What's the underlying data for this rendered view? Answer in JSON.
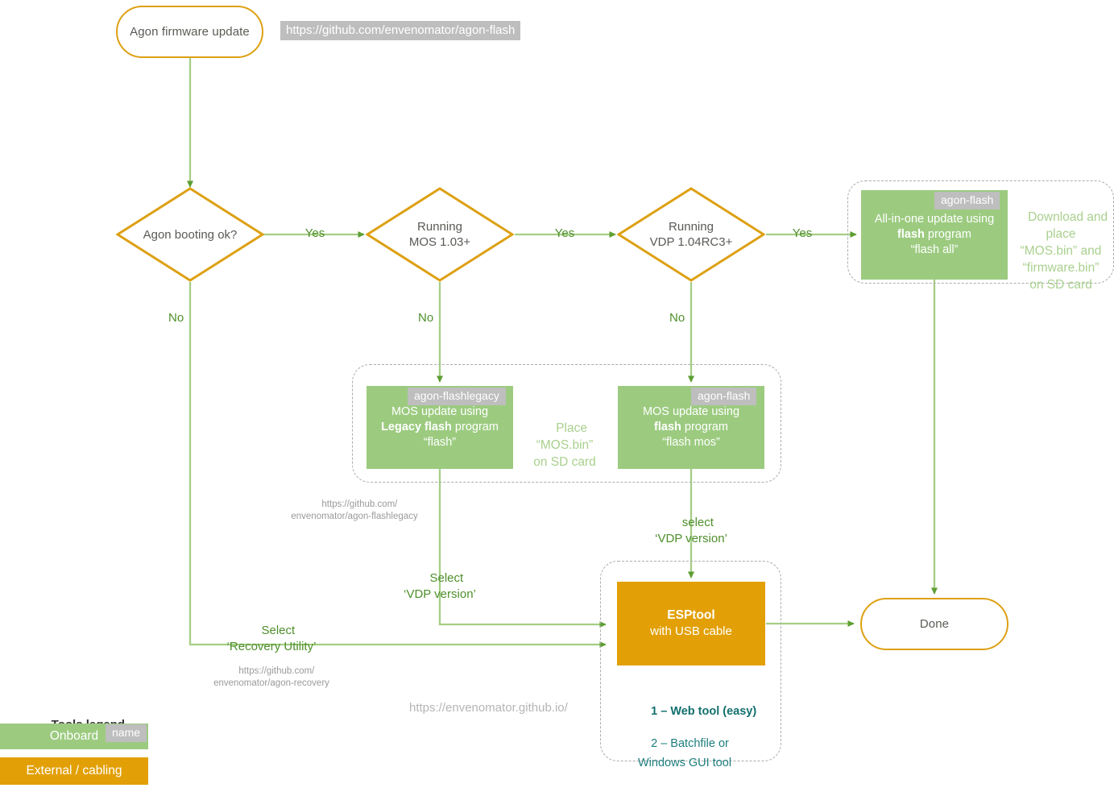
{
  "diagram": {
    "title_node": "Agon firmware update",
    "top_url": "https://github.com/envenomator/agon-flash",
    "end_node": "Done"
  },
  "decisions": [
    {
      "id": "boot",
      "text": "Agon booting ok?",
      "yes": "Yes",
      "no": "No"
    },
    {
      "id": "mos",
      "line1": "Running",
      "line2": "MOS 1.03+",
      "yes": "Yes",
      "no": "No"
    },
    {
      "id": "vdp",
      "line1": "Running",
      "line2": "VDP 1.04RC3+",
      "yes": "Yes",
      "no": "No"
    }
  ],
  "processes": {
    "all_in_one": {
      "tag": "agon-flash",
      "line1": "All-in-one update using",
      "line2_bold": "flash",
      "line2_rest": " program",
      "line3": "“flash all”",
      "side_note": "Download and place\n“MOS.bin” and\n“firmware.bin”\non SD card"
    },
    "legacy": {
      "tag": "agon-flashlegacy",
      "line1": "MOS update using",
      "line2_bold": "Legacy flash",
      "line2_rest": " program",
      "line3": "“flash”",
      "url": "https://github.com/\nenvenomator/agon-flashlegacy"
    },
    "mos_flash": {
      "tag": "agon-flash",
      "line1": "MOS update using",
      "line2_bold": "flash",
      "line2_rest": " program",
      "line3": "“flash mos”"
    },
    "place_note": "Place\n“MOS.bin”\non SD card",
    "esptool": {
      "line1": "ESPtool",
      "line2": "with USB cable",
      "option1_num": "1 – ",
      "option1": "Web tool (easy)",
      "option2": "2 – Batchfile or\n      Windows GUI tool",
      "url": "https://envenomator.github.io/"
    }
  },
  "edge_labels": {
    "select_vdp_left": "Select\n‘VDP version’",
    "select_vdp_right": "select\n‘VDP version’",
    "select_recovery": "Select\n‘Recovery Utility’",
    "recovery_url": "https://github.com/\nenvenomator/agon-recovery"
  },
  "legend": {
    "title": "Tools legend",
    "onboard": "Onboard",
    "onboard_tag": "name",
    "external": "External / cabling"
  },
  "colors": {
    "green_fill": "#9CCB80",
    "orange_fill": "#E2A006",
    "orange_stroke": "#DDA012",
    "line_green": "#A5CE85",
    "arrow_green": "#5D9E33",
    "label_green": "#4E8F2B",
    "gray_tag": "#BEBEBE",
    "teal": "#1D7D7D"
  }
}
